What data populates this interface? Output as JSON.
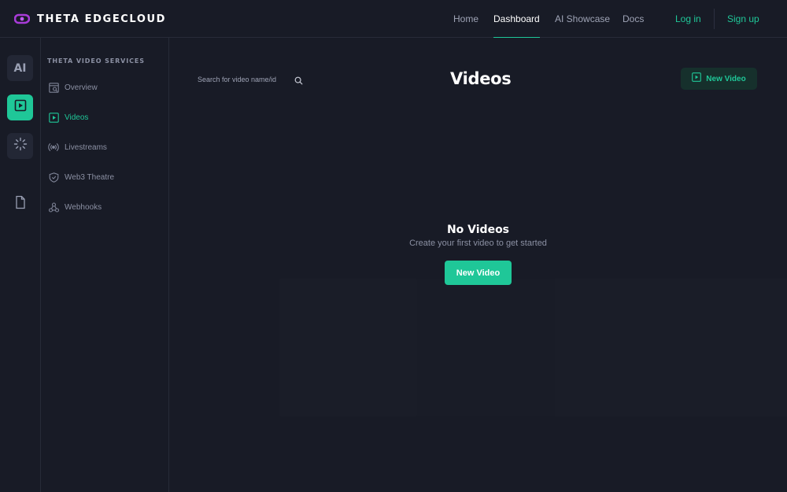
{
  "brand": {
    "name": "THETA EDGECLOUD",
    "accent": "#1fc798",
    "logo_color": "#a83bd8"
  },
  "nav": {
    "items": [
      {
        "label": "Home",
        "active": false
      },
      {
        "label": "Dashboard",
        "active": true
      },
      {
        "label": "AI Showcase",
        "active": false
      },
      {
        "label": "Docs",
        "active": false
      }
    ],
    "login": "Log in",
    "signup": "Sign up"
  },
  "rail": {
    "ai_label": "AI",
    "icons": [
      "ai-icon",
      "video-icon",
      "loader-icon",
      "document-icon"
    ]
  },
  "sidemenu": {
    "heading": "THETA VIDEO SERVICES",
    "items": [
      {
        "label": "Overview",
        "icon": "overview-icon",
        "active": false
      },
      {
        "label": "Videos",
        "icon": "video-icon",
        "active": true
      },
      {
        "label": "Livestreams",
        "icon": "broadcast-icon",
        "active": false
      },
      {
        "label": "Web3 Theatre",
        "icon": "shield-icon",
        "active": false
      },
      {
        "label": "Webhooks",
        "icon": "webhook-icon",
        "active": false
      }
    ]
  },
  "main": {
    "search": {
      "placeholder": "Search for video name/id",
      "value": ""
    },
    "title": "Videos",
    "new_video_label": "New Video",
    "empty": {
      "title": "No Videos",
      "subtitle": "Create your first video to get started",
      "button": "New Video"
    }
  }
}
